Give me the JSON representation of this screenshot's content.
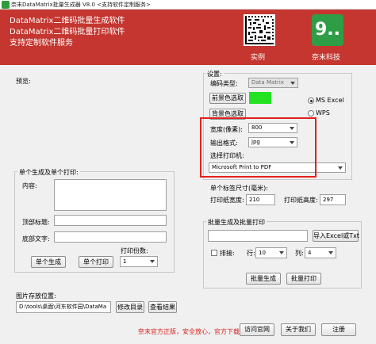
{
  "window": {
    "title": "奈末DataMatrix批量生成器 V8.0  <支持软件定制服务>"
  },
  "banner": {
    "line1": "DataMatrix二维码批量生成软件",
    "line2": "DataMatrix二维码批量打印软件",
    "line3": "支持定制软件服务",
    "example_caption": "实例",
    "brand_caption": "奈末科技",
    "logo_text": "9..",
    "background": "#c4362f"
  },
  "preview": {
    "label": "预览:"
  },
  "settings": {
    "group_label": "设置:",
    "code_type_label": "编码类型:",
    "code_type_value": "Data Matrix",
    "fg_color_button": "前景色选取",
    "fg_color": "#22e222",
    "bg_color_button": "背景色选取",
    "office_options": [
      "MS  Excel",
      "WPS"
    ],
    "office_selected": "MS  Excel",
    "width_label": "宽度(像素):",
    "width_value": "800",
    "format_label": "输出格式:",
    "format_value": "jpg",
    "printer_label": "选择打印机:",
    "printer_value": "Microsoft Print to PDF"
  },
  "label_size": {
    "title": "单个标签尺寸(毫米):",
    "print_width_label": "打印纸宽度:",
    "print_width_value": "210",
    "print_height_label": "打印纸高度:",
    "print_height_value": "297"
  },
  "single": {
    "group_label": "单个生成及单个打印:",
    "content_label": "内容:",
    "content_value": "",
    "top_label": "顶部标题:",
    "top_value": "",
    "bottom_label": "底部文字:",
    "bottom_value": "",
    "copies_label": "打印份数:",
    "copies_value": "1",
    "generate_button": "单个生成",
    "print_button": "单个打印"
  },
  "batch": {
    "group_label": "批量生成及批量打印",
    "file_value": "",
    "import_button": "导入Excel或Txt",
    "layout_label": "排接:",
    "rows_label": "行:",
    "rows_value": "10",
    "cols_label": "列:",
    "cols_value": "4",
    "generate_button": "批量生成",
    "print_button": "批量打印"
  },
  "save": {
    "label": "图片存放位置:",
    "path_value": "D:\\tools\\桌面\\河东软件园\\DataMa",
    "change_button": "修改目录",
    "view_button": "查看结果"
  },
  "footer": {
    "note": "奈末官方正版，安全放心，官方下载--->",
    "visit_button": "访问官网",
    "about_button": "关于我们",
    "register_button": "注册"
  },
  "highlight_color": "#e2201b"
}
